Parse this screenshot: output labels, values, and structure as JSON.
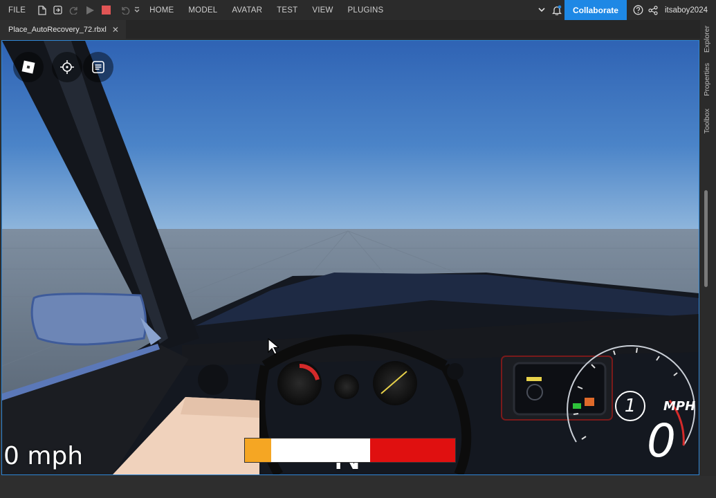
{
  "menu": {
    "file": "FILE",
    "home": "HOME",
    "model": "MODEL",
    "avatar": "AVATAR",
    "test": "TEST",
    "view": "VIEW",
    "plugins": "PLUGINS"
  },
  "header": {
    "collaborate": "Collaborate",
    "username": "itsaboy2024"
  },
  "tab": {
    "title": "Place_AutoRecovery_72.rbxl",
    "close": "✕"
  },
  "side_tabs": [
    "Explorer",
    "Properties",
    "Toolbox"
  ],
  "hud": {
    "gear_indicator": "N",
    "speed_text": "0 mph",
    "gauge_gear": "1",
    "gauge_speed": "0",
    "gauge_unit": "MPH"
  },
  "colors": {
    "accent": "#1e88e5",
    "record": "#e05555",
    "bar_orange": "#f5a623",
    "bar_red": "#e01010"
  }
}
